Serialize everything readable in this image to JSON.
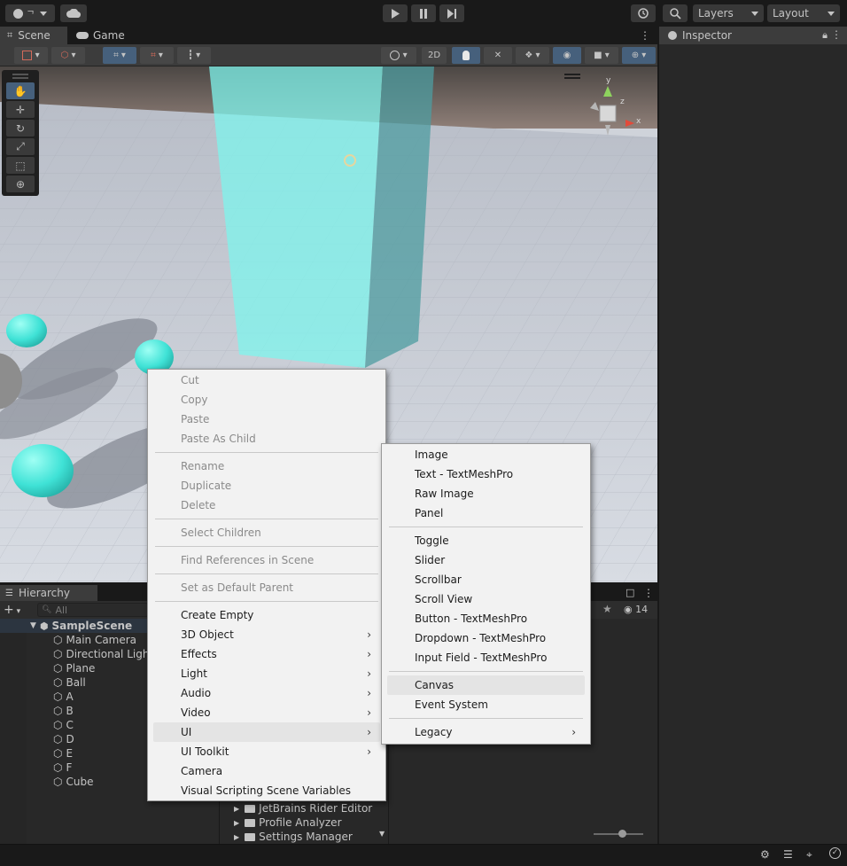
{
  "toolbar": {
    "layers_label": "Layers",
    "layout_label": "Layout"
  },
  "tabs": {
    "scene": "Scene",
    "game": "Game",
    "inspector": "Inspector"
  },
  "scene_toolbar": {
    "mode_2d": "2D",
    "hidden_count": "14"
  },
  "hierarchy": {
    "title": "Hierarchy",
    "search_placeholder": "All",
    "scene_name": "SampleScene",
    "objects": [
      "Main Camera",
      "Directional Light",
      "Plane",
      "Ball",
      "A",
      "B",
      "C",
      "D",
      "E",
      "F",
      "Cube"
    ]
  },
  "project": {
    "folders": [
      "JetBrains Rider Editor",
      "Profile Analyzer",
      "Settings Manager"
    ]
  },
  "context_menu": {
    "items": [
      {
        "label": "Cut",
        "disabled": true
      },
      {
        "label": "Copy",
        "disabled": true
      },
      {
        "label": "Paste",
        "disabled": true
      },
      {
        "label": "Paste As Child",
        "disabled": true
      },
      {
        "label": "Rename",
        "disabled": true
      },
      {
        "label": "Duplicate",
        "disabled": true
      },
      {
        "label": "Delete",
        "disabled": true
      },
      {
        "label": "Select Children",
        "disabled": true
      },
      {
        "label": "Find References in Scene",
        "disabled": true
      },
      {
        "label": "Set as Default Parent",
        "disabled": true
      },
      {
        "label": "Create Empty",
        "disabled": false
      },
      {
        "label": "3D Object",
        "disabled": false,
        "submenu": true
      },
      {
        "label": "Effects",
        "disabled": false,
        "submenu": true
      },
      {
        "label": "Light",
        "disabled": false,
        "submenu": true
      },
      {
        "label": "Audio",
        "disabled": false,
        "submenu": true
      },
      {
        "label": "Video",
        "disabled": false,
        "submenu": true
      },
      {
        "label": "UI",
        "disabled": false,
        "submenu": true,
        "highlighted": true
      },
      {
        "label": "UI Toolkit",
        "disabled": false,
        "submenu": true
      },
      {
        "label": "Camera",
        "disabled": false
      },
      {
        "label": "Visual Scripting Scene Variables",
        "disabled": false
      }
    ]
  },
  "ui_submenu": {
    "items": [
      {
        "label": "Image"
      },
      {
        "label": "Text - TextMeshPro"
      },
      {
        "label": "Raw Image"
      },
      {
        "label": "Panel"
      },
      {
        "label": "Toggle"
      },
      {
        "label": "Slider"
      },
      {
        "label": "Scrollbar"
      },
      {
        "label": "Scroll View"
      },
      {
        "label": "Button - TextMeshPro"
      },
      {
        "label": "Dropdown - TextMeshPro"
      },
      {
        "label": "Input Field - TextMeshPro"
      },
      {
        "label": "Canvas",
        "highlighted": true
      },
      {
        "label": "Event System"
      },
      {
        "label": "Legacy",
        "submenu": true
      }
    ]
  },
  "colors": {
    "accent": "#46607c",
    "panel": "#282828",
    "menu_bg": "#f2f2f2"
  }
}
